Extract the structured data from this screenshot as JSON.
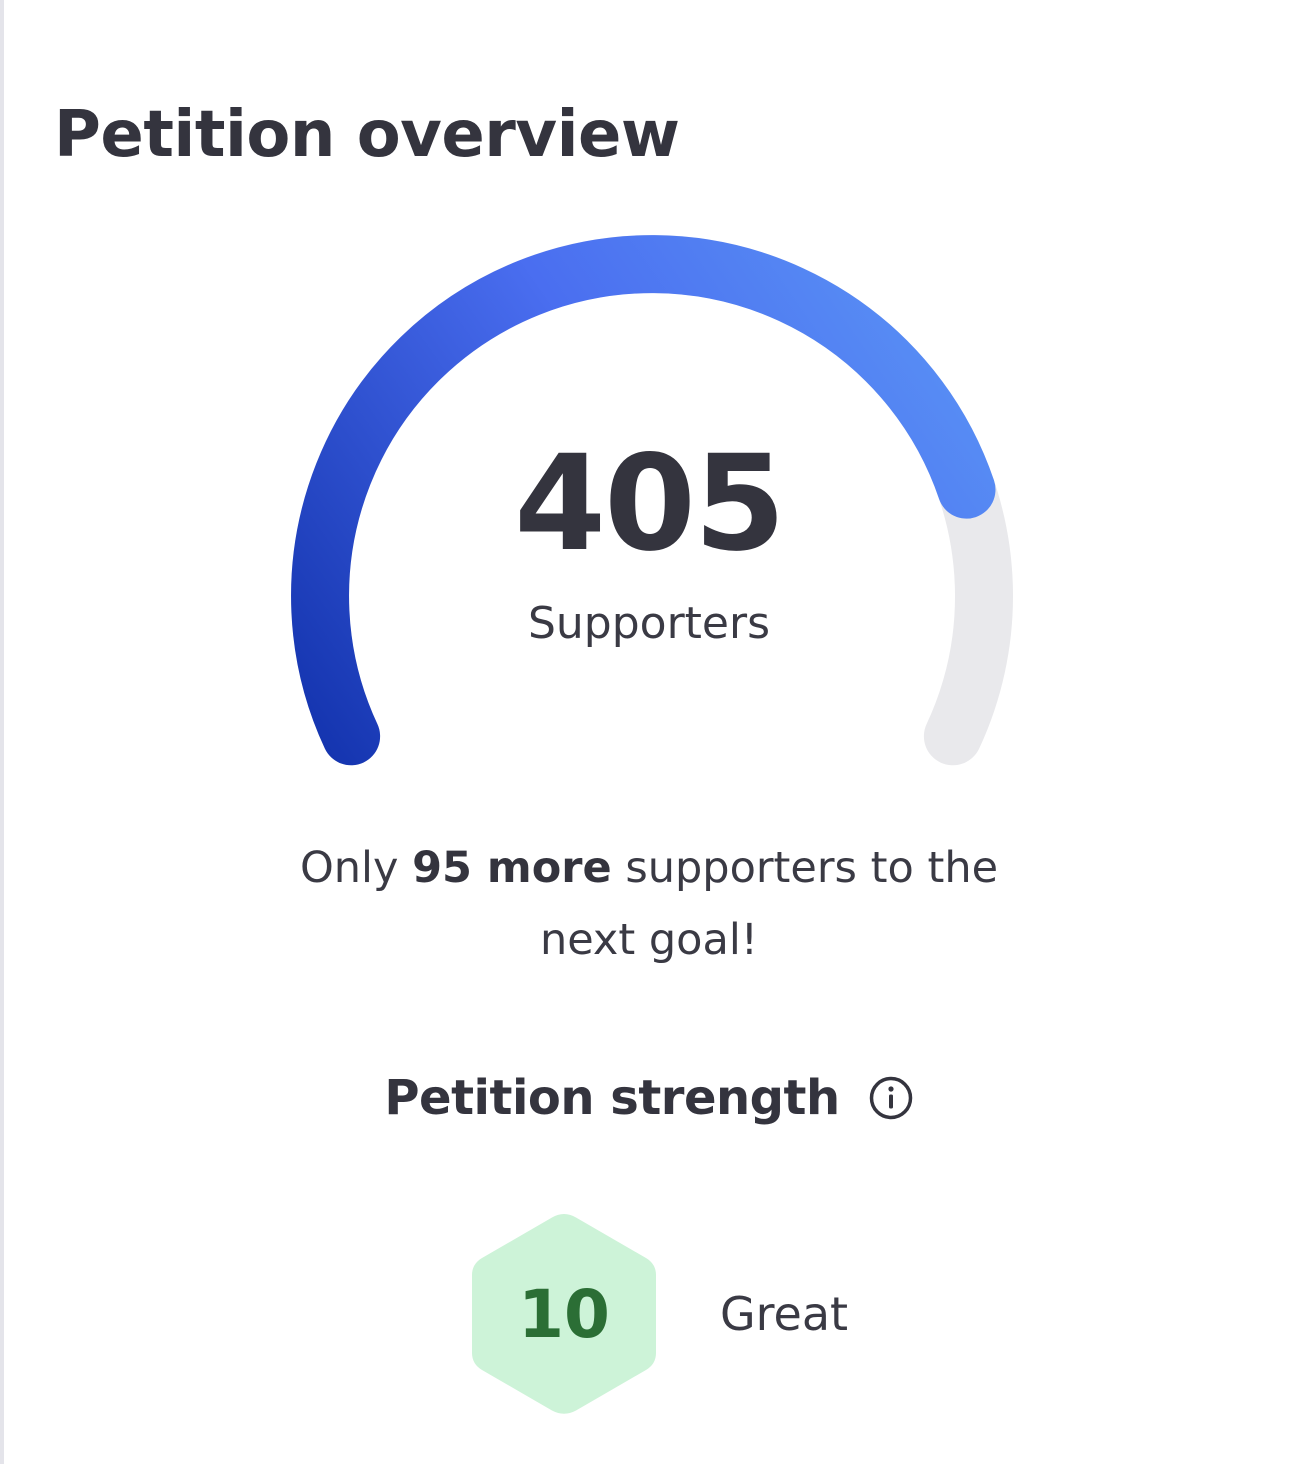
{
  "overview": {
    "title": "Petition overview",
    "supporters_count": "405",
    "supporters_label": "Supporters",
    "goal_message": {
      "prefix": "Only",
      "highlight": "95 more",
      "suffix": "supporters to the next goal!"
    },
    "progress_fraction": 0.81,
    "progress_colors": {
      "start": "#1535b0",
      "mid": "#4a6ef0",
      "end": "#5b95f5",
      "track": "#e9e9ec"
    }
  },
  "strength": {
    "title": "Petition strength",
    "info_icon": "info-circle-icon",
    "score": "10",
    "rating": "Great",
    "badge_fill": "#cdf3d8",
    "score_color": "#2b6e35"
  }
}
